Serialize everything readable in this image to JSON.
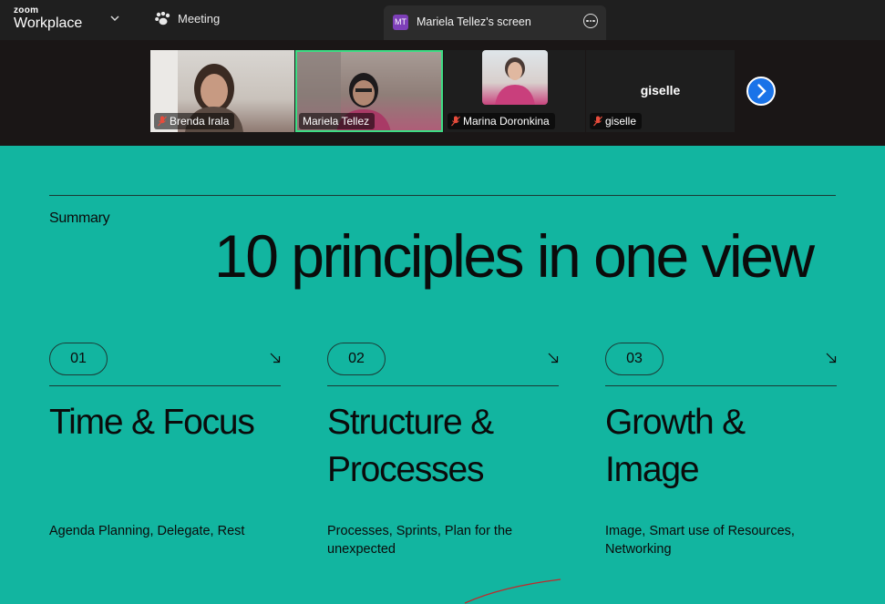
{
  "app": {
    "logo_line1": "zoom",
    "logo_line2": "Workplace",
    "meeting_tab": "Meeting",
    "screen_tab": {
      "initials": "MT",
      "title": "Mariela Tellez's screen"
    }
  },
  "participants": [
    {
      "name": "Brenda Irala",
      "muted": true
    },
    {
      "name": "Mariela Tellez",
      "muted": false,
      "active_speaker": true
    },
    {
      "name": "Marina Doronkina",
      "muted": true
    },
    {
      "name": "giselle",
      "muted": true,
      "display_name": "giselle"
    }
  ],
  "slide": {
    "section": "Summary",
    "headline": "10 principles in one view",
    "columns": [
      {
        "number": "01",
        "title": "Time & Focus",
        "desc": "Agenda Planning, Delegate, Rest"
      },
      {
        "number": "02",
        "title": "Structure & Processes",
        "desc": "Processes, Sprints, Plan for the unexpected"
      },
      {
        "number": "03",
        "title": "Growth & Image",
        "desc": "Image, Smart use of Resources, Networking"
      }
    ]
  },
  "colors": {
    "slide_bg": "#12b5a0",
    "topbar_bg": "#1f1f1f",
    "active_speaker": "#3ddc84",
    "next_button": "#1a73e8",
    "annotation": "#c0292b"
  },
  "icons": {
    "meeting": "paw-icon",
    "more": "more-icon",
    "next": "chevron-right-icon",
    "mic": "mic-muted-icon",
    "arrow": "arrow-down-right-icon"
  }
}
